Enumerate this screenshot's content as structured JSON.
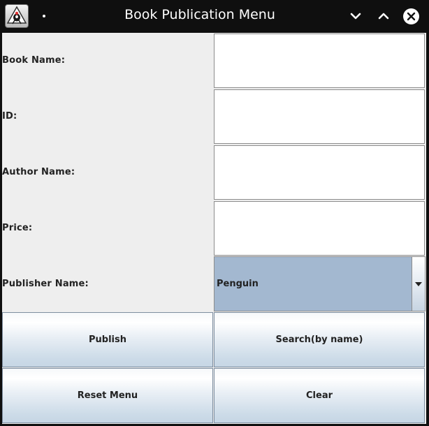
{
  "window": {
    "title": "Book Publication Menu"
  },
  "titlebar": {
    "icons": [
      "java-app-icon",
      "window-menu-icon",
      "minimize-icon",
      "maximize-icon",
      "close-icon"
    ]
  },
  "form": {
    "book_name_label": "Book Name:",
    "book_name_value": "",
    "id_label": "ID:",
    "id_value": "",
    "author_name_label": "Author Name:",
    "author_name_value": "",
    "price_label": "Price:",
    "price_value": "",
    "publisher_name_label": "Publisher Name:",
    "publisher_selected": "Penguin"
  },
  "buttons": {
    "publish": "Publish",
    "search": "Search(by name)",
    "reset": "Reset Menu",
    "clear": "Clear"
  },
  "colors": {
    "titlebar_bg": "#0f0f0f",
    "panel_bg": "#eeeeee",
    "combo_bg": "#a3b8d0",
    "button_gradient_bottom": "#c6d6e4"
  }
}
